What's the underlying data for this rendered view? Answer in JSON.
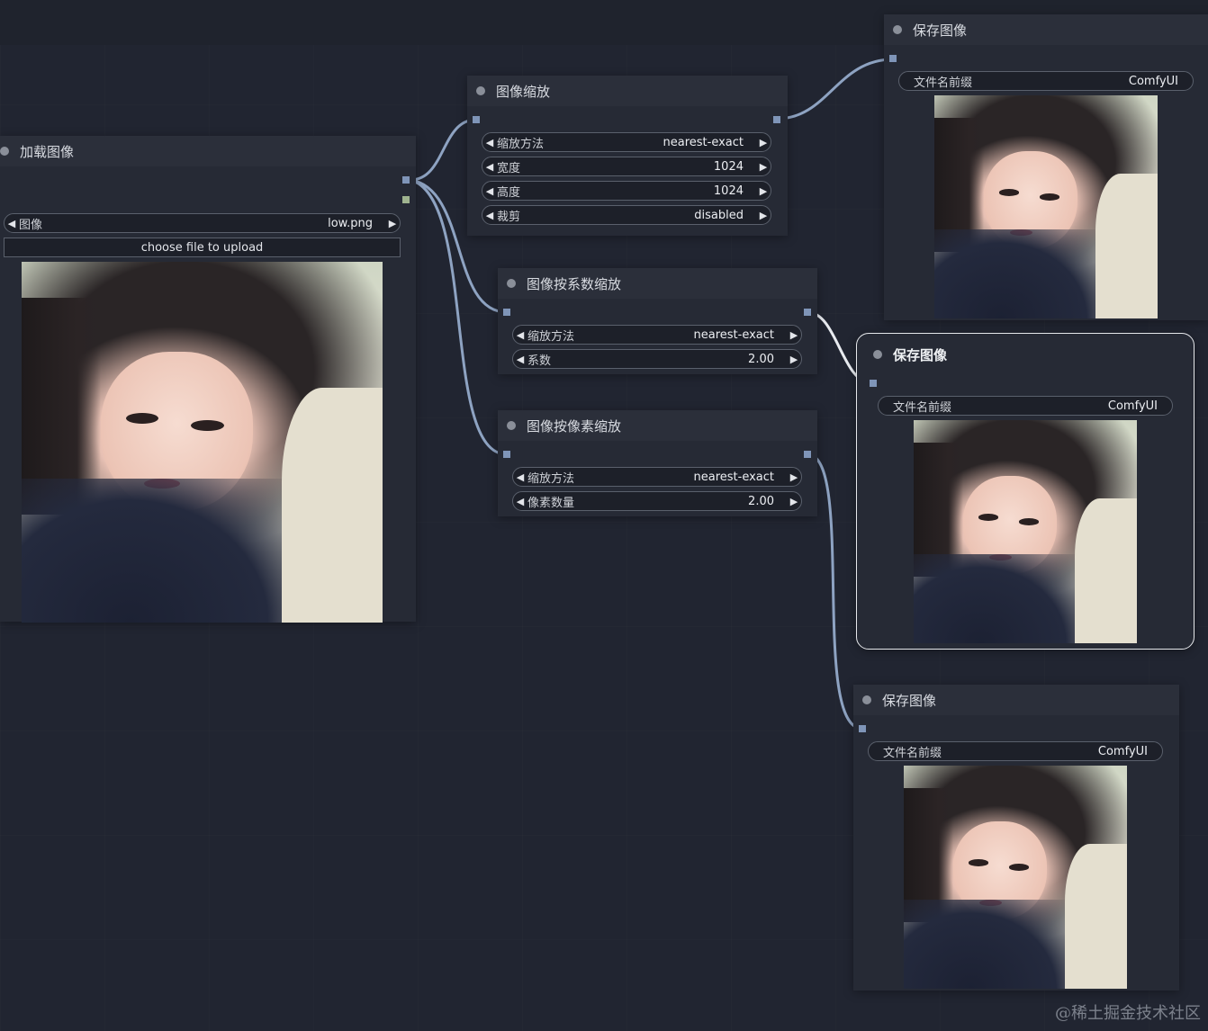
{
  "nodes": {
    "load_image": {
      "title": "加载图像",
      "image_widget": {
        "label": "图像",
        "value": "low.png"
      },
      "upload_button": "choose file to upload"
    },
    "image_scale": {
      "title": "图像缩放",
      "widgets": [
        {
          "label": "缩放方法",
          "value": "nearest-exact"
        },
        {
          "label": "宽度",
          "value": "1024"
        },
        {
          "label": "高度",
          "value": "1024"
        },
        {
          "label": "裁剪",
          "value": "disabled"
        }
      ]
    },
    "image_scale_by": {
      "title": "图像按系数缩放",
      "widgets": [
        {
          "label": "缩放方法",
          "value": "nearest-exact"
        },
        {
          "label": "系数",
          "value": "2.00"
        }
      ]
    },
    "image_scale_pixels": {
      "title": "图像按像素缩放",
      "widgets": [
        {
          "label": "缩放方法",
          "value": "nearest-exact"
        },
        {
          "label": "像素数量",
          "value": "2.00"
        }
      ]
    },
    "save_image_1": {
      "title": "保存图像",
      "prefix_label": "文件名前缀",
      "prefix_value": "ComfyUI"
    },
    "save_image_2": {
      "title": "保存图像",
      "prefix_label": "文件名前缀",
      "prefix_value": "ComfyUI"
    },
    "save_image_3": {
      "title": "保存图像",
      "prefix_label": "文件名前缀",
      "prefix_value": "ComfyUI"
    }
  },
  "icons": {
    "left_arrow": "left-triangle-icon",
    "right_arrow": "right-triangle-icon"
  },
  "colors": {
    "link": "#8ea3c2",
    "slot_image": "#7f95b8",
    "slot_mask": "#9fb38f",
    "canvas": "#212531"
  },
  "watermark": "@稀土掘金技术社区"
}
